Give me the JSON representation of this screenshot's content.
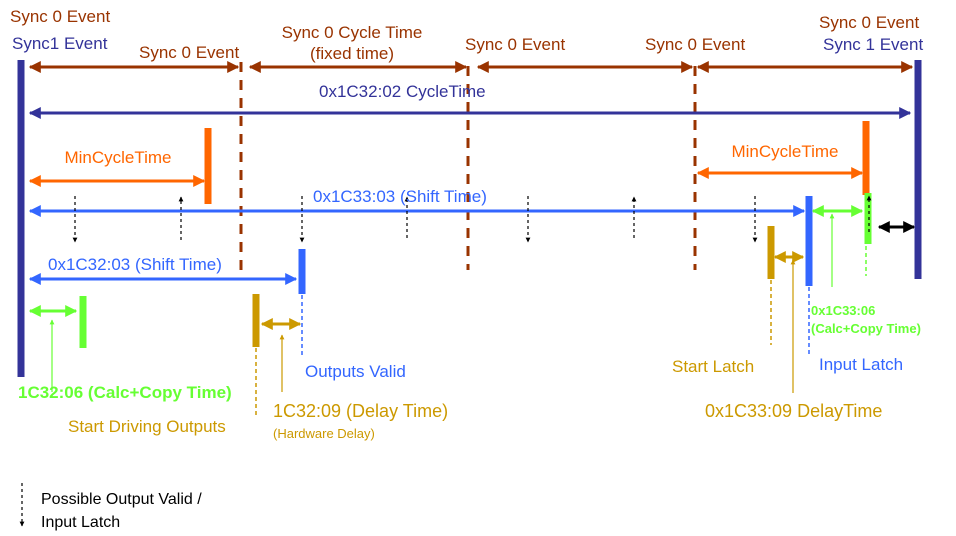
{
  "colors": {
    "sync0": "#993300",
    "sync1": "#333399",
    "min_cycle": "#ff6600",
    "shift": "#3366ff",
    "calc_copy": "#66ff33",
    "delay": "#cc9900",
    "legend": "#000000"
  },
  "top": {
    "left_sync0": "Sync 0 Event",
    "left_sync1": "Sync1 Event",
    "sync0_event_1": "Sync 0 Event",
    "cycle_time_line1": "Sync 0 Cycle Time",
    "cycle_time_line2": "(fixed time)",
    "sync0_event_2": "Sync 0 Event",
    "sync0_event_3": "Sync 0 Event",
    "right_sync0": "Sync 0 Event",
    "right_sync1": "Sync 1 Event"
  },
  "cycle_time": "0x1C32:02 CycleTime",
  "min_cycle_left": "MinCycleTime",
  "min_cycle_right": "MinCycleTime",
  "input_shift": "0x1C33:03 (Shift Time)",
  "output_shift": "0x1C32:03 (Shift Time)",
  "output": {
    "calc_copy": "1C32:06 (Calc+Copy Time)",
    "start_driving": "Start Driving Outputs",
    "outputs_valid": "Outputs Valid",
    "delay_time": "1C32:09 (Delay Time)",
    "hardware_delay": "(Hardware Delay)"
  },
  "input": {
    "start_latch": "Start Latch",
    "delay_time": "0x1C33:09 DelayTime",
    "input_latch": "Input Latch",
    "calc_copy_line1": "0x1C33:06",
    "calc_copy_line2": "(Calc+Copy Time)"
  },
  "legend": {
    "icon": "dashed-down-arrow-icon",
    "line1": "Possible Output Valid /",
    "line2": "Input Latch"
  }
}
